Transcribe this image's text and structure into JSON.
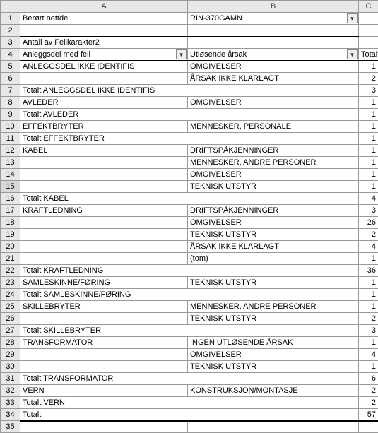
{
  "columns": {
    "A": "A",
    "B": "B",
    "C": "C"
  },
  "r1": {
    "a": "Berørt nettdel",
    "b": "RIN-370GAMN"
  },
  "r3": {
    "a": "Antall av Feilkarakter2"
  },
  "r4": {
    "a": "Anleggsdel med feil",
    "b": "Utløsende årsak",
    "c": "Totalt"
  },
  "r5": {
    "a": "ANLEGGSDEL IKKE IDENTIFIS",
    "b": "OMGIVELSER",
    "c": "1"
  },
  "r6": {
    "b": "ÅRSAK IKKE KLARLAGT",
    "c": "2"
  },
  "r7": {
    "a": "Totalt ANLEGGSDEL IKKE IDENTIFIS",
    "c": "3"
  },
  "r8": {
    "a": "AVLEDER",
    "b": "OMGIVELSER",
    "c": "1"
  },
  "r9": {
    "a": "Totalt AVLEDER",
    "c": "1"
  },
  "r10": {
    "a": "EFFEKTBRYTER",
    "b": "MENNESKER, PERSONALE",
    "c": "1"
  },
  "r11": {
    "a": "Totalt EFFEKTBRYTER",
    "c": "1"
  },
  "r12": {
    "a": "KABEL",
    "b": "DRIFTSPÅKJENNINGER",
    "c": "1"
  },
  "r13": {
    "b": "MENNESKER, ANDRE PERSONER",
    "c": "1"
  },
  "r14": {
    "b": "OMGIVELSER",
    "c": "1"
  },
  "r15": {
    "b": "TEKNISK UTSTYR",
    "c": "1"
  },
  "r16": {
    "a": "Totalt KABEL",
    "c": "4"
  },
  "r17": {
    "a": "KRAFTLEDNING",
    "b": "DRIFTSPÅKJENNINGER",
    "c": "3"
  },
  "r18": {
    "b": "OMGIVELSER",
    "c": "26"
  },
  "r19": {
    "b": "TEKNISK UTSTYR",
    "c": "2"
  },
  "r20": {
    "b": "ÅRSAK IKKE KLARLAGT",
    "c": "4"
  },
  "r21": {
    "b": "(tom)",
    "c": "1"
  },
  "r22": {
    "a": "Totalt KRAFTLEDNING",
    "c": "36"
  },
  "r23": {
    "a": "SAMLESKINNE/FØRING",
    "b": "TEKNISK UTSTYR",
    "c": "1"
  },
  "r24": {
    "a": "Totalt SAMLESKINNE/FØRING",
    "c": "1"
  },
  "r25": {
    "a": "SKILLEBRYTER",
    "b": "MENNESKER, ANDRE PERSONER",
    "c": "1"
  },
  "r26": {
    "b": "TEKNISK UTSTYR",
    "c": "2"
  },
  "r27": {
    "a": "Totalt SKILLEBRYTER",
    "c": "3"
  },
  "r28": {
    "a": "TRANSFORMATOR",
    "b": "INGEN UTLØSENDE ÅRSAK",
    "c": "1"
  },
  "r29": {
    "b": "OMGIVELSER",
    "c": "4"
  },
  "r30": {
    "b": "TEKNISK UTSTYR",
    "c": "1"
  },
  "r31": {
    "a": "Totalt TRANSFORMATOR",
    "c": "6"
  },
  "r32": {
    "a": "VERN",
    "b": "KONSTRUKSJON/MONTASJE",
    "c": "2"
  },
  "r33": {
    "a": "Totalt VERN",
    "c": "2"
  },
  "r34": {
    "a": "Totalt",
    "c": "57"
  },
  "chart_data": {
    "type": "table",
    "title": "Antall av Feilkarakter2",
    "filter": {
      "Berørt nettdel": "RIN-370GAMN"
    },
    "columns": [
      "Anleggsdel med feil",
      "Utløsende årsak",
      "Totalt"
    ],
    "rows": [
      [
        "ANLEGGSDEL IKKE IDENTIFIS",
        "OMGIVELSER",
        1
      ],
      [
        "ANLEGGSDEL IKKE IDENTIFIS",
        "ÅRSAK IKKE KLARLAGT",
        2
      ],
      [
        "Totalt ANLEGGSDEL IKKE IDENTIFIS",
        "",
        3
      ],
      [
        "AVLEDER",
        "OMGIVELSER",
        1
      ],
      [
        "Totalt AVLEDER",
        "",
        1
      ],
      [
        "EFFEKTBRYTER",
        "MENNESKER, PERSONALE",
        1
      ],
      [
        "Totalt EFFEKTBRYTER",
        "",
        1
      ],
      [
        "KABEL",
        "DRIFTSPÅKJENNINGER",
        1
      ],
      [
        "KABEL",
        "MENNESKER, ANDRE PERSONER",
        1
      ],
      [
        "KABEL",
        "OMGIVELSER",
        1
      ],
      [
        "KABEL",
        "TEKNISK UTSTYR",
        1
      ],
      [
        "Totalt KABEL",
        "",
        4
      ],
      [
        "KRAFTLEDNING",
        "DRIFTSPÅKJENNINGER",
        3
      ],
      [
        "KRAFTLEDNING",
        "OMGIVELSER",
        26
      ],
      [
        "KRAFTLEDNING",
        "TEKNISK UTSTYR",
        2
      ],
      [
        "KRAFTLEDNING",
        "ÅRSAK IKKE KLARLAGT",
        4
      ],
      [
        "KRAFTLEDNING",
        "(tom)",
        1
      ],
      [
        "Totalt KRAFTLEDNING",
        "",
        36
      ],
      [
        "SAMLESKINNE/FØRING",
        "TEKNISK UTSTYR",
        1
      ],
      [
        "Totalt SAMLESKINNE/FØRING",
        "",
        1
      ],
      [
        "SKILLEBRYTER",
        "MENNESKER, ANDRE PERSONER",
        1
      ],
      [
        "SKILLEBRYTER",
        "TEKNISK UTSTYR",
        2
      ],
      [
        "Totalt SKILLEBRYTER",
        "",
        3
      ],
      [
        "TRANSFORMATOR",
        "INGEN UTLØSENDE ÅRSAK",
        1
      ],
      [
        "TRANSFORMATOR",
        "OMGIVELSER",
        4
      ],
      [
        "TRANSFORMATOR",
        "TEKNISK UTSTYR",
        1
      ],
      [
        "Totalt TRANSFORMATOR",
        "",
        6
      ],
      [
        "VERN",
        "KONSTRUKSJON/MONTASJE",
        2
      ],
      [
        "Totalt VERN",
        "",
        2
      ],
      [
        "Totalt",
        "",
        57
      ]
    ]
  }
}
